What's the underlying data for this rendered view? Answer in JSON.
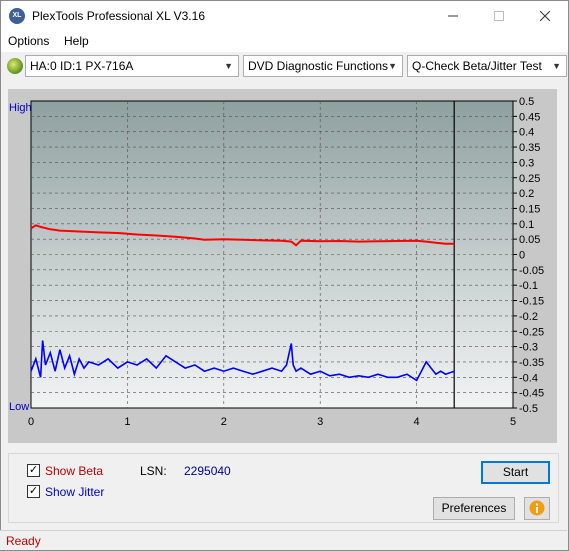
{
  "window": {
    "title": "PlexTools Professional XL V3.16",
    "icon_text": "XL"
  },
  "menu": {
    "options": "Options",
    "help": "Help"
  },
  "toolbar": {
    "drive": "HA:0 ID:1  PX-716A",
    "function": "DVD Diagnostic Functions",
    "test": "Q-Check Beta/Jitter Test"
  },
  "chart_data": {
    "type": "line",
    "left_axis_labels": {
      "high": "High",
      "low": "Low"
    },
    "x_ticks": [
      "0",
      "1",
      "2",
      "3",
      "4",
      "5"
    ],
    "xlim": [
      0,
      5
    ],
    "y_ticks": [
      "0.5",
      "0.45",
      "0.4",
      "0.35",
      "0.3",
      "0.25",
      "0.2",
      "0.15",
      "0.1",
      "0.05",
      "0",
      "-0.05",
      "-0.1",
      "-0.15",
      "-0.2",
      "-0.25",
      "-0.3",
      "-0.35",
      "-0.4",
      "-0.45",
      "-0.5"
    ],
    "ylim": [
      -0.5,
      0.5
    ],
    "grid": true,
    "end_marker_x": 4.39,
    "series": [
      {
        "color": "#ff0000",
        "x": [
          0,
          0.05,
          0.1,
          0.2,
          0.3,
          0.5,
          0.7,
          0.9,
          1.1,
          1.3,
          1.5,
          1.7,
          1.8,
          2.0,
          2.2,
          2.4,
          2.6,
          2.7,
          2.75,
          2.8,
          3.0,
          3.2,
          3.4,
          3.6,
          3.8,
          4.0,
          4.1,
          4.2,
          4.3,
          4.39
        ],
        "y": [
          0.085,
          0.095,
          0.09,
          0.082,
          0.078,
          0.075,
          0.072,
          0.07,
          0.065,
          0.062,
          0.058,
          0.052,
          0.048,
          0.05,
          0.048,
          0.046,
          0.045,
          0.042,
          0.03,
          0.045,
          0.043,
          0.044,
          0.042,
          0.043,
          0.044,
          0.045,
          0.042,
          0.038,
          0.035,
          0.035
        ]
      },
      {
        "color": "#0000ff",
        "x": [
          0,
          0.05,
          0.1,
          0.12,
          0.15,
          0.2,
          0.25,
          0.3,
          0.35,
          0.4,
          0.45,
          0.5,
          0.55,
          0.6,
          0.7,
          0.8,
          0.9,
          1.0,
          1.1,
          1.2,
          1.3,
          1.4,
          1.5,
          1.6,
          1.7,
          1.8,
          1.9,
          2.0,
          2.1,
          2.2,
          2.3,
          2.4,
          2.5,
          2.6,
          2.65,
          2.7,
          2.72,
          2.75,
          2.8,
          2.9,
          3.0,
          3.1,
          3.2,
          3.3,
          3.4,
          3.5,
          3.6,
          3.7,
          3.8,
          3.9,
          4.0,
          4.05,
          4.1,
          4.15,
          4.2,
          4.25,
          4.3,
          4.39
        ],
        "y": [
          -0.38,
          -0.34,
          -0.4,
          -0.28,
          -0.36,
          -0.32,
          -0.38,
          -0.31,
          -0.37,
          -0.33,
          -0.39,
          -0.34,
          -0.37,
          -0.35,
          -0.36,
          -0.34,
          -0.37,
          -0.35,
          -0.36,
          -0.34,
          -0.37,
          -0.33,
          -0.35,
          -0.37,
          -0.36,
          -0.38,
          -0.37,
          -0.38,
          -0.37,
          -0.38,
          -0.39,
          -0.38,
          -0.37,
          -0.38,
          -0.36,
          -0.29,
          -0.36,
          -0.38,
          -0.37,
          -0.39,
          -0.38,
          -0.395,
          -0.39,
          -0.4,
          -0.395,
          -0.4,
          -0.39,
          -0.4,
          -0.4,
          -0.39,
          -0.41,
          -0.38,
          -0.35,
          -0.37,
          -0.39,
          -0.38,
          -0.39,
          -0.38
        ]
      }
    ]
  },
  "controls": {
    "show_beta": "Show Beta",
    "show_jitter": "Show Jitter",
    "lsn_label": "LSN:",
    "lsn_value": "2295040",
    "start": "Start",
    "preferences": "Preferences"
  },
  "status": {
    "text": "Ready"
  }
}
